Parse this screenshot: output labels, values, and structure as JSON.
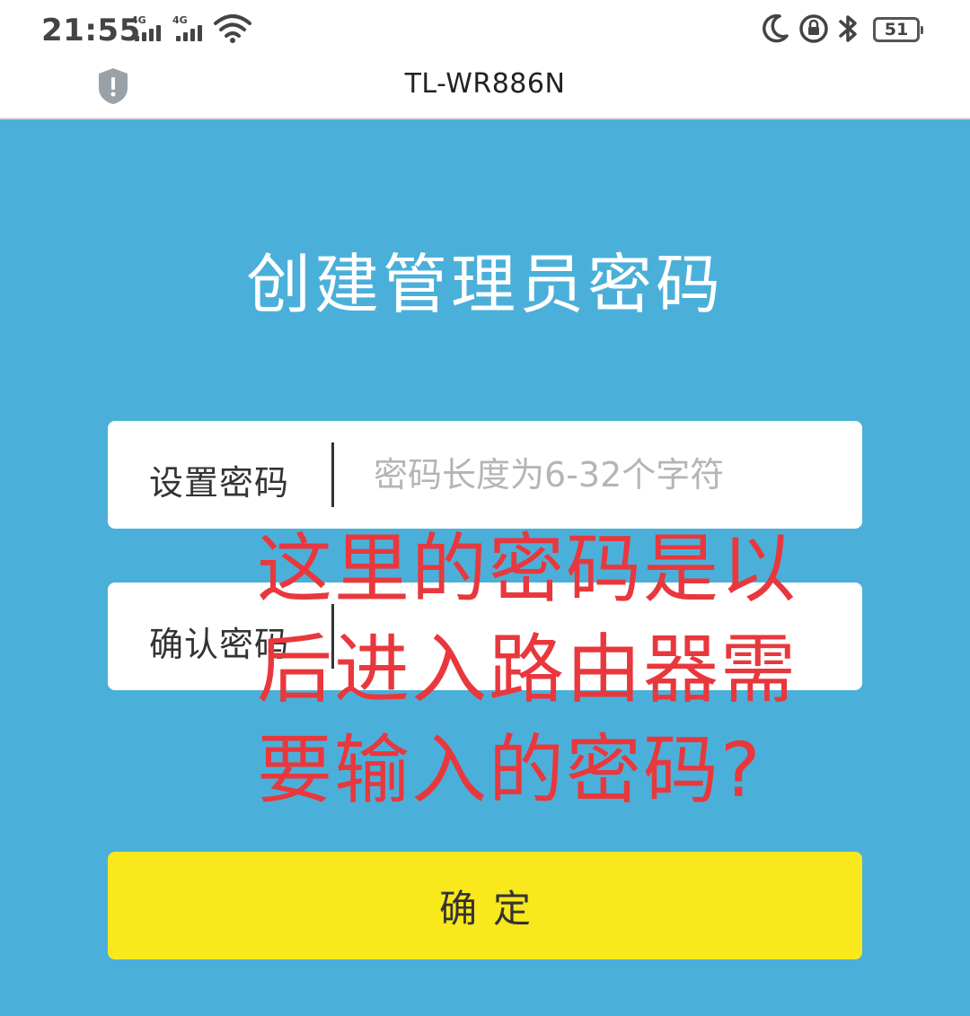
{
  "status_bar": {
    "time": "21:55",
    "signal_1_label": "4G",
    "signal_2_label": "4G",
    "battery_level": "51"
  },
  "browser": {
    "page_title": "TL-WR886N"
  },
  "form": {
    "heading": "创建管理员密码",
    "password_label": "设置密码",
    "password_placeholder": "密码长度为6-32个字符",
    "confirm_label": "确认密码",
    "confirm_placeholder": "",
    "submit_label": "确定"
  },
  "annotation": {
    "text": "这里的密码是以\n后进入路由器需\n要输入的密码?"
  },
  "colors": {
    "background": "#4bb0d9",
    "button": "#f9e81c",
    "annotation": "#e8383d"
  }
}
